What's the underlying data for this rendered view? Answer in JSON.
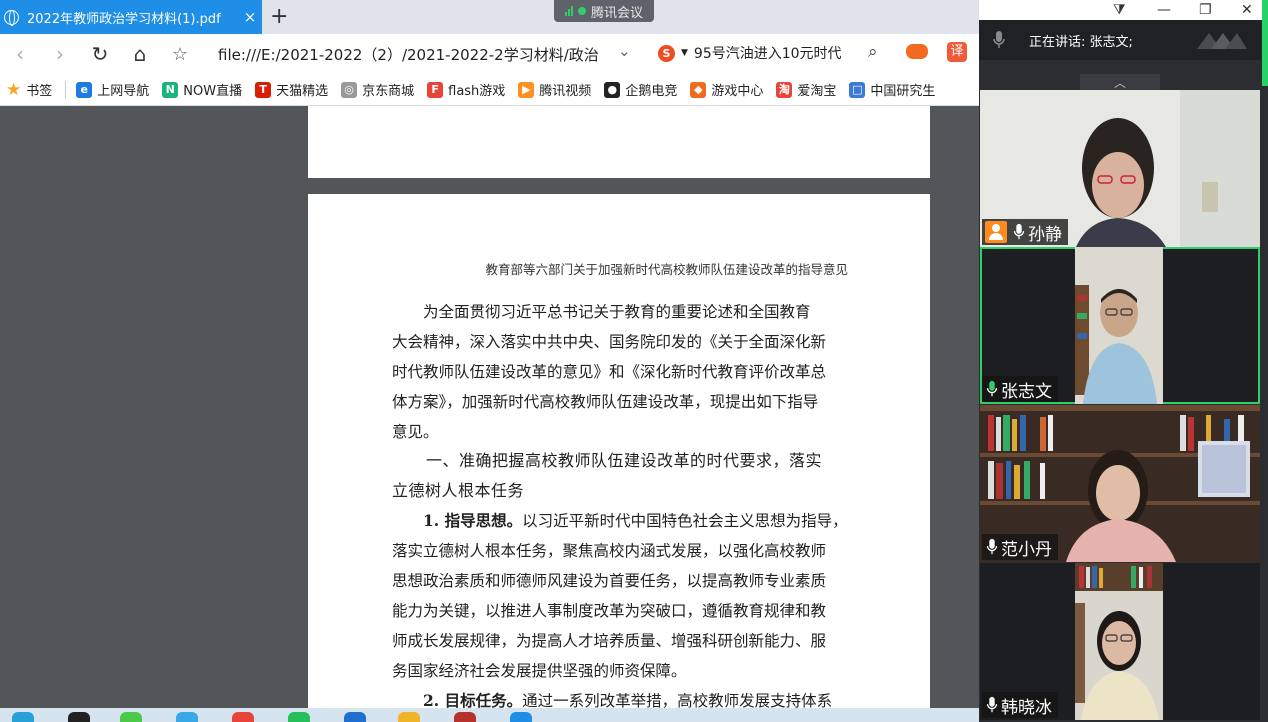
{
  "browser": {
    "tab_title": "2022年教师政治学习材料(1).pdf",
    "tab_close": "×",
    "new_tab": "+",
    "address": "file:///E:/2021-2022（2）/2021-2022-2学习材料/政治",
    "search_text": "95号汽油进入10元时代",
    "sogou_letter": "S",
    "translate_glyph": "译",
    "bookmarks": [
      {
        "label": "书签"
      },
      {
        "label": "上网导航",
        "icon_color": "#1e7be0",
        "glyph": "e"
      },
      {
        "label": "NOW直播",
        "icon_color": "#1bb37a",
        "glyph": "N"
      },
      {
        "label": "天猫精选",
        "icon_color": "#d81e06",
        "glyph": "T"
      },
      {
        "label": "京东商城",
        "icon_color": "#999999",
        "glyph": "◎"
      },
      {
        "label": "flash游戏",
        "icon_color": "#e8443a",
        "glyph": "F"
      },
      {
        "label": "腾讯视频",
        "icon_color": "#ff8f1f",
        "glyph": "▶"
      },
      {
        "label": "企鹅电竞",
        "icon_color": "#222222",
        "glyph": "●"
      },
      {
        "label": "游戏中心",
        "icon_color": "#f26a1f",
        "glyph": "◆"
      },
      {
        "label": "爱淘宝",
        "icon_color": "#e8443a",
        "glyph": "淘"
      },
      {
        "label": "中国研究生",
        "icon_color": "#3a7bd5",
        "glyph": "□"
      }
    ]
  },
  "meeting_pill": "腾讯会议",
  "pdf": {
    "running_header": "教育部等六部门关于加强新时代高校教师队伍建设改革的指导意见",
    "intro_lines": [
      "为全面贯彻习近平总书记关于教育的重要论述和全国教育",
      "大会精神，深入落实中共中央、国务院印发的《关于全面深化新",
      "时代教师队伍建设改革的意见》和《深化新时代教育评价改革总",
      "体方案》，加强新时代高校教师队伍建设改革，现提出如下指导",
      "意见。"
    ],
    "section_lines": [
      "一、准确把握高校教师队伍建设改革的时代要求，落实",
      "立德树人根本任务"
    ],
    "p1_lead": "1. 指导思想。",
    "p1_lines": [
      "以习近平新时代中国特色社会主义思想为指导，",
      "落实立德树人根本任务，聚焦高校内涵式发展，以强化高校教师",
      "思想政治素质和师德师风建设为首要任务，以提高教师专业素质",
      "能力为关键，以推进人事制度改革为突破口，遵循教育规律和教",
      "师成长发展规律，为提高人才培养质量、增强科研创新能力、服",
      "务国家经济社会发展提供坚强的师资保障。"
    ],
    "p2_lead": "2. 目标任务。",
    "p2_line": "通过一系列改革举措，高校教师发展支持体系"
  },
  "meeting": {
    "speaking_label": "正在讲话: 张志文;",
    "collapse_glyph": "︿",
    "participants": [
      {
        "name": "孙静",
        "host": true
      },
      {
        "name": "张志文",
        "host": false
      },
      {
        "name": "范小丹",
        "host": false
      },
      {
        "name": "韩晓冰",
        "host": false
      }
    ]
  }
}
